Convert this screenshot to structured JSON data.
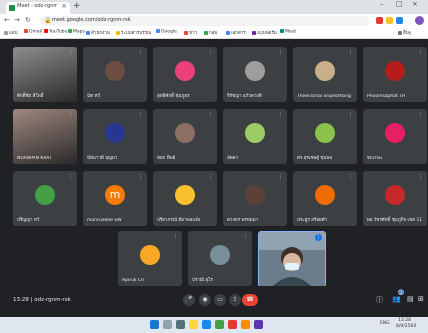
{
  "browser": {
    "tab_title": "Meet - odz-rgnm-rsk",
    "url": "meet.google.com/odz-rgnm-rsk",
    "bookmarks": [
      "แอป",
      "Gmail",
      "YouTube",
      "Maps",
      "สำนักงาน",
      "ระบบสารบรรณ",
      "Google",
      "ข่าว",
      "กลุ่ม",
      "เอกสาร",
      "แบบฟอร์ม",
      "Meet",
      "อื่นๆ"
    ]
  },
  "participants": [
    {
      "name": "ศักดิ์ชัย สีโพธิ์",
      "kind": "photo",
      "color": "#8d8d8d"
    },
    {
      "name": "นัท ทวี",
      "kind": "avatar",
      "color": "#6d4c41"
    },
    {
      "name": "สุทธิศักดิ์ ชุมภูธร",
      "kind": "avatar",
      "color": "#ec407a"
    },
    {
      "name": "จิรัชญา แก้วดวงดี",
      "kind": "avatar",
      "color": "#9e9e9e"
    },
    {
      "name": "Theerachai Sriphothong",
      "kind": "avatar",
      "color": "#c8b08a"
    },
    {
      "name": "Phoomsaphat TH",
      "kind": "avatar",
      "color": "#b71c1c"
    },
    {
      "name": "NUANPAN KRAT",
      "kind": "photo",
      "color": "#a1887f"
    },
    {
      "name": "ปัทมาวดี บุญมา",
      "kind": "avatar",
      "color": "#283593"
    },
    {
      "name": "หยก ทิพย์",
      "kind": "avatar",
      "color": "#8d6e63"
    },
    {
      "name": "ลัดดา",
      "kind": "avatar",
      "color": "#9ccc65"
    },
    {
      "name": "ดร.สุรเชษฐ์ ชุมพล",
      "kind": "avatar",
      "color": "#8bc34a"
    },
    {
      "name": "Wichai",
      "kind": "avatar",
      "color": "#e91e63"
    },
    {
      "name": "ปริญญา ทวี",
      "kind": "avatar",
      "color": "#43a047"
    },
    {
      "name": "monruedee SW",
      "kind": "letter",
      "letter": "m",
      "color": "#f57c00"
    },
    {
      "name": "ปรียาภรณ์ สีมาพลแจ้ง",
      "kind": "avatar",
      "color": "#fbc02d"
    },
    {
      "name": "ดวงพร พรหมมา",
      "kind": "avatar",
      "color": "#5d4037"
    },
    {
      "name": "ประยูร สร้อยคำ",
      "kind": "avatar",
      "color": "#ef6c00"
    },
    {
      "name": "ผอ.วัชรศักดิ์ ชุมภูกิจ เขต 11",
      "kind": "avatar",
      "color": "#c62828"
    },
    {
      "name": "Apiruk Ch",
      "kind": "avatar",
      "color": "#f9a825"
    },
    {
      "name": "ปราณี อุไร",
      "kind": "avatar",
      "color": "#78909c"
    }
  ],
  "meeting": {
    "time": "13:28",
    "code": "odz-rgnm-rsk",
    "separator": "|"
  },
  "controls": {
    "mic": "🎤",
    "camera": "◉",
    "captions": "▭",
    "present": "⇪",
    "more": "⋮",
    "end": "☎",
    "participants_count": "21"
  },
  "taskbar": {
    "clock_time": "13:28",
    "clock_date": "8/9/2564",
    "lang": "ENG"
  },
  "colors": {
    "meet_bg": "#202124",
    "tile_bg": "#3c4043",
    "end_call": "#ea4335",
    "accent": "#8ab4f8"
  }
}
